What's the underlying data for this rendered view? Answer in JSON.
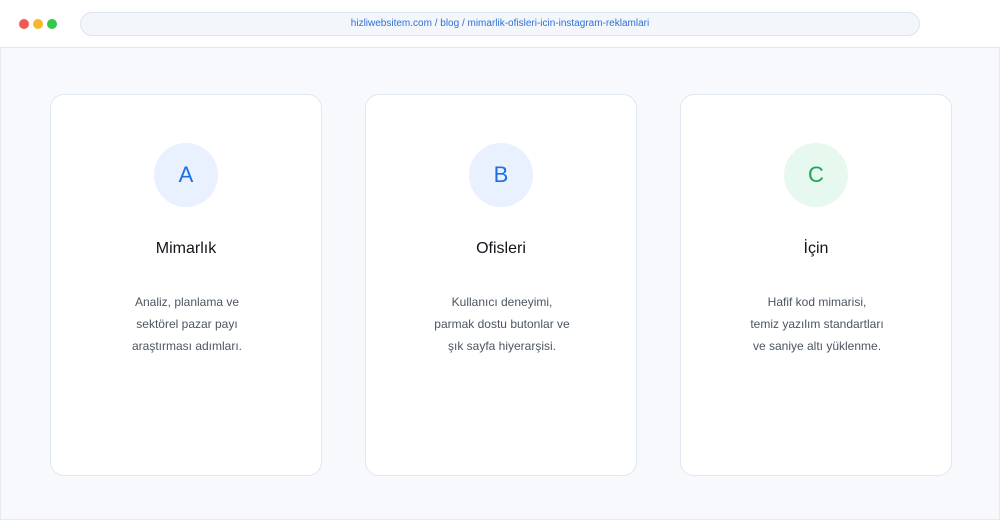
{
  "browser": {
    "url": "hizliwebsitem.com / blog / mimarlik-ofisleri-icin-instagram-reklamlari"
  },
  "cards": [
    {
      "letter": "A",
      "title": "Mimarlık",
      "lines": [
        "Analiz, planlama ve",
        "sektörel pazar payı",
        "araştırması adımları."
      ]
    },
    {
      "letter": "B",
      "title": "Ofisleri",
      "lines": [
        "Kullanıcı deneyimi,",
        "parmak dostu butonlar ve",
        "şık sayfa hiyerarşisi."
      ]
    },
    {
      "letter": "C",
      "title": "İçin",
      "lines": [
        "Hafif kod mimarisi,",
        "temiz yazılım standartları",
        "ve saniye altı yüklenme."
      ]
    }
  ],
  "colors": {
    "accent_blue": "#1e6fe0",
    "accent_green": "#20a45a",
    "window_close": "#ee5a52",
    "window_minimize": "#f5b92d",
    "window_maximize": "#34c748"
  }
}
